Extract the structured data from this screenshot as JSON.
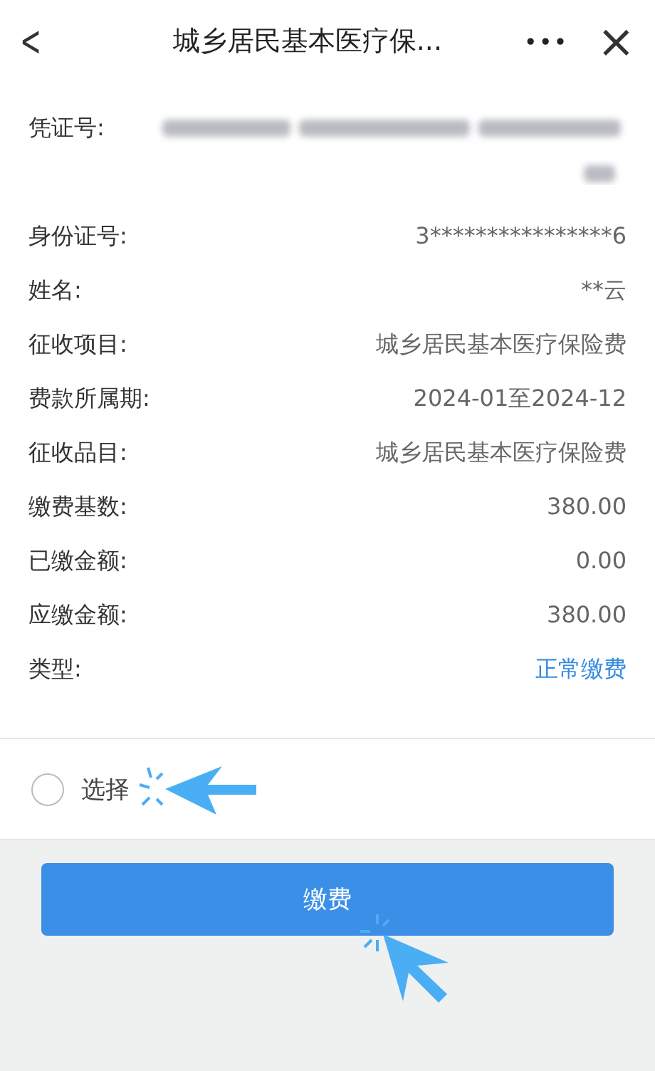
{
  "header": {
    "back": "<",
    "title": "城乡居民基本医疗保...",
    "more": "•••",
    "close": "×"
  },
  "rows": [
    {
      "kind": "redacted",
      "label": "凭证号:"
    },
    {
      "kind": "text",
      "label": "身份证号:",
      "value": "3****************6"
    },
    {
      "kind": "text",
      "label": "姓名:",
      "value": "**云"
    },
    {
      "kind": "text",
      "label": "征收项目:",
      "value": "城乡居民基本医疗保险费"
    },
    {
      "kind": "text",
      "label": "费款所属期:",
      "value": "2024-01至2024-12"
    },
    {
      "kind": "text",
      "label": "征收品目:",
      "value": "城乡居民基本医疗保险费"
    },
    {
      "kind": "text",
      "label": "缴费基数:",
      "value": "380.00"
    },
    {
      "kind": "text",
      "label": "已缴金额:",
      "value": "0.00"
    },
    {
      "kind": "text",
      "label": "应缴金额:",
      "value": "380.00"
    },
    {
      "kind": "link",
      "label": "类型:",
      "value": "正常缴费"
    }
  ],
  "choice": {
    "label": "选择",
    "selected": false
  },
  "pay_button": "缴费"
}
